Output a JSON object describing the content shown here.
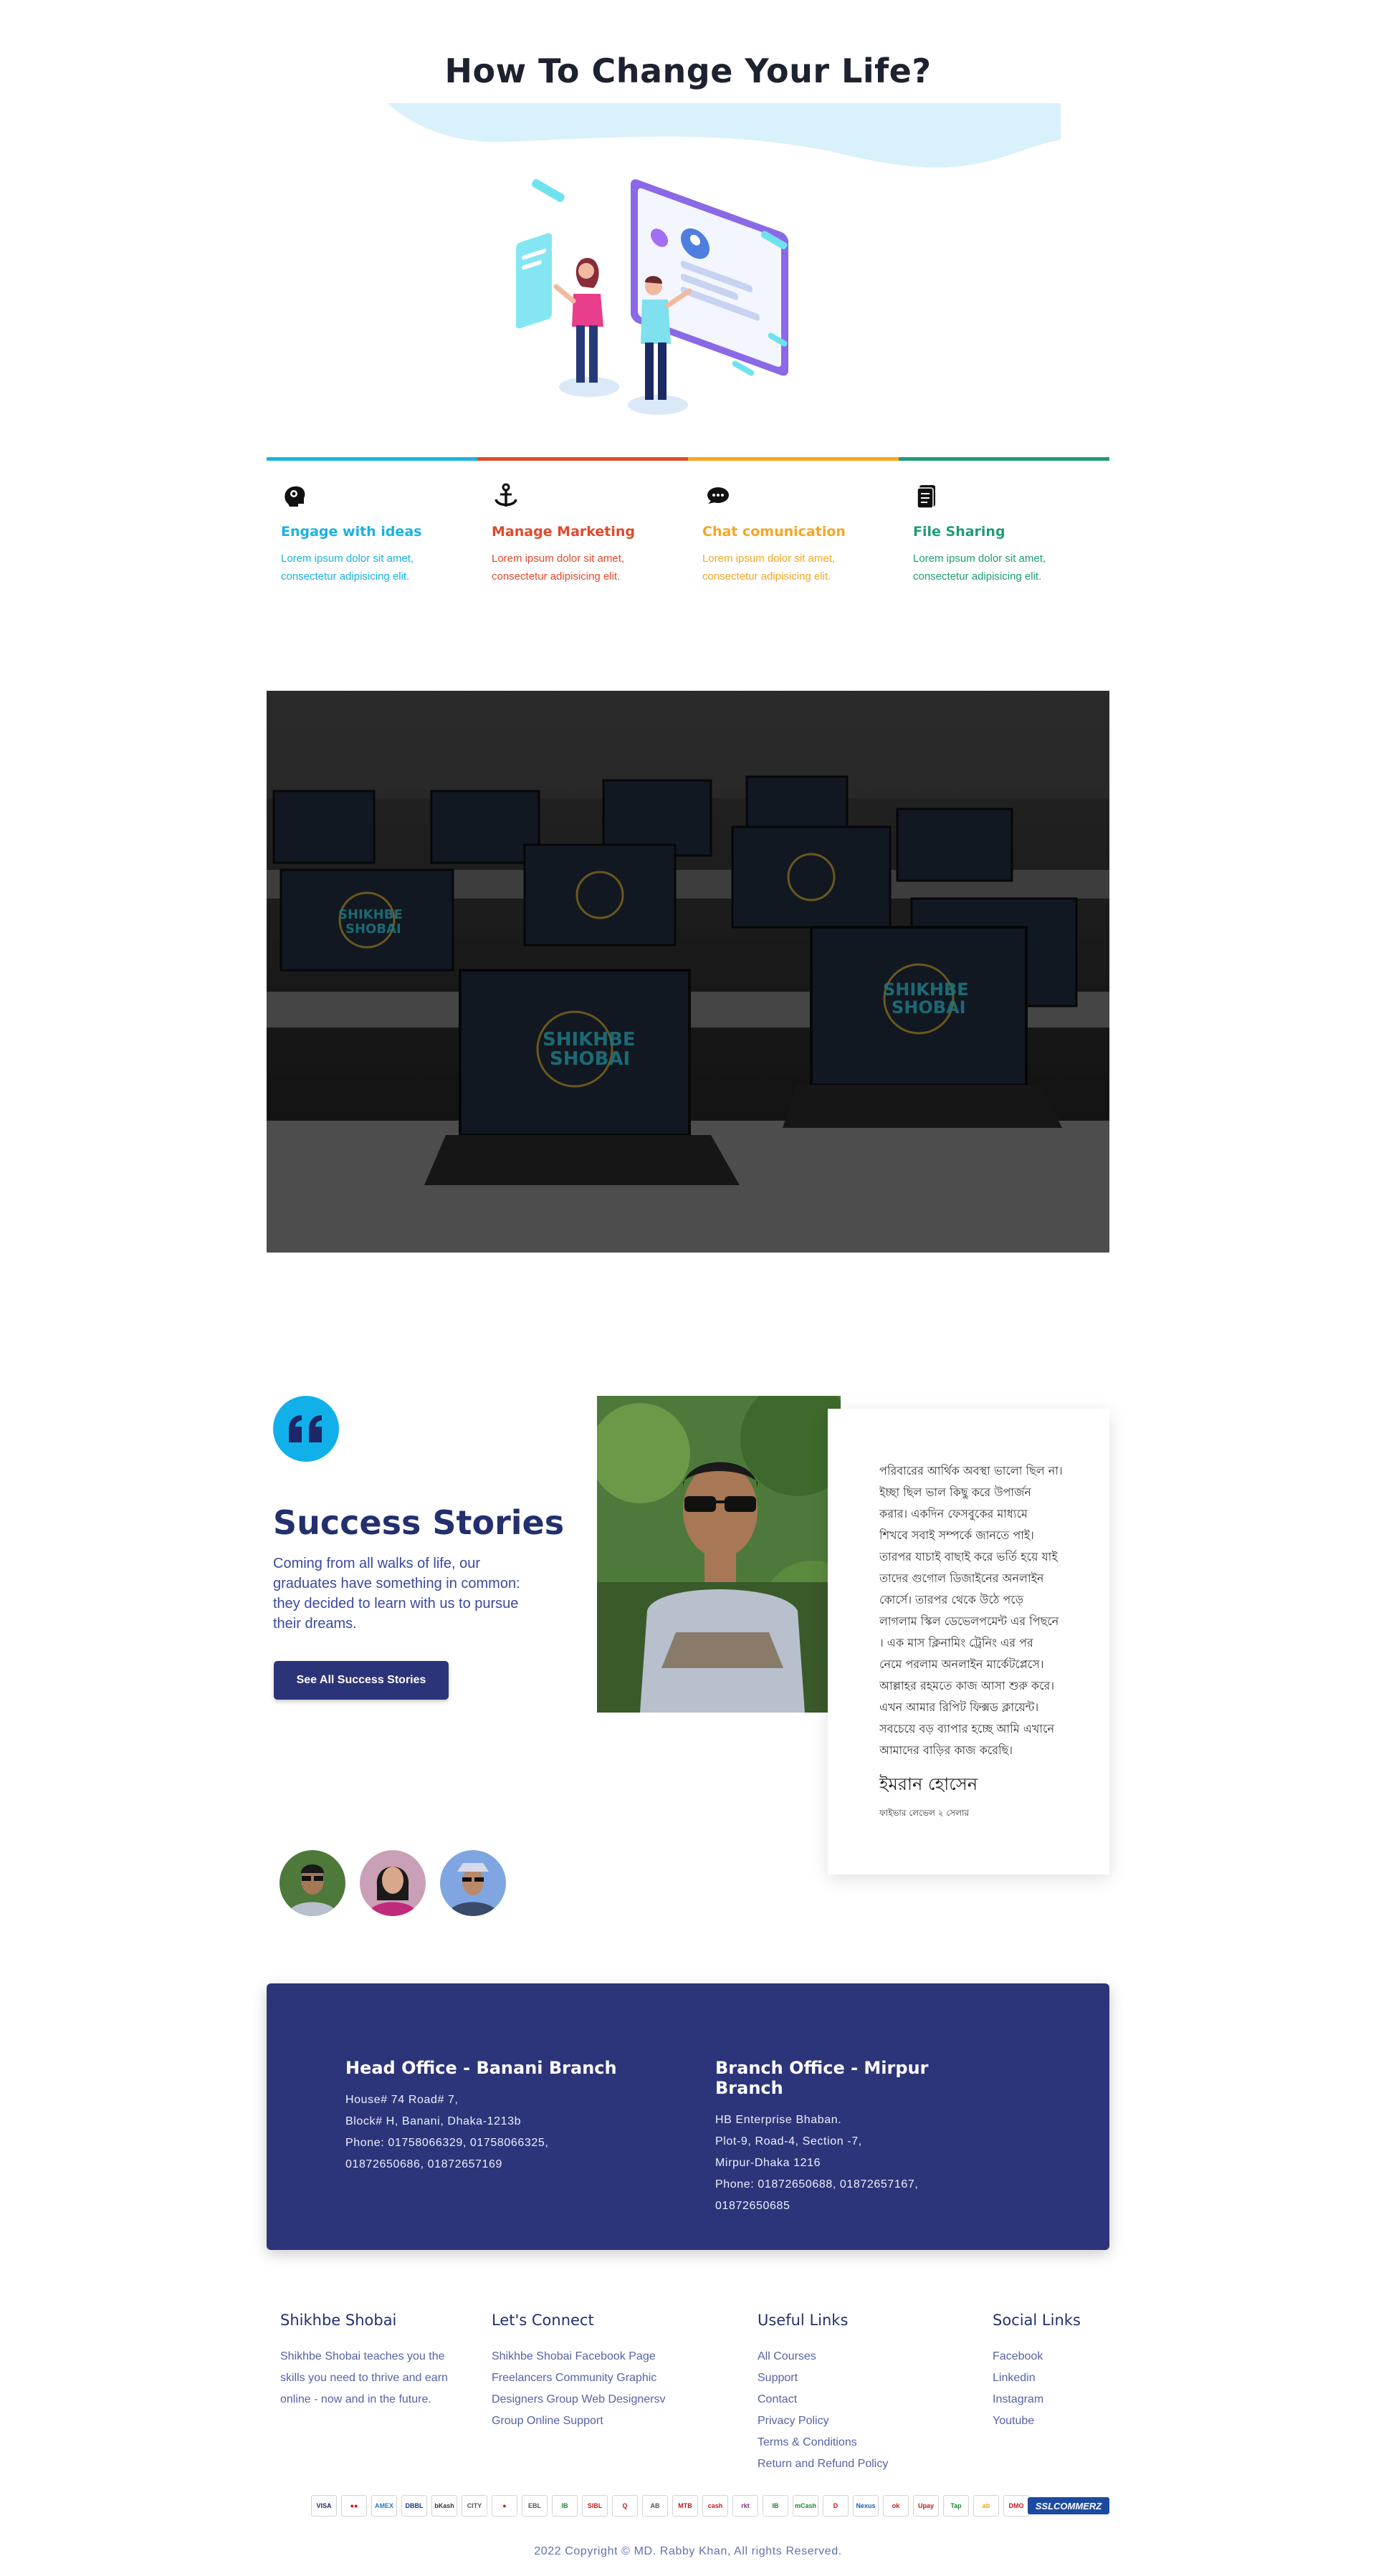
{
  "hero": {
    "title": "How To Change Your Life?"
  },
  "features": [
    {
      "icon": "brain-icon",
      "title": "Engage with ideas",
      "desc": "Lorem ipsum dolor sit amet, consectetur adipisicing elit.",
      "color": "#1ab2e0"
    },
    {
      "icon": "anchor-icon",
      "title": "Manage Marketing",
      "desc": "Lorem ipsum dolor sit amet, consectetur adipisicing elit.",
      "color": "#e0492c"
    },
    {
      "icon": "chat-icon",
      "title": "Chat comunication",
      "desc": "Lorem ipsum dolor sit amet, consectetur adipisicing elit.",
      "color": "#f5a623"
    },
    {
      "icon": "file-icon",
      "title": "File Sharing",
      "desc": "Lorem ipsum dolor sit amet, consectetur adipisicing elit.",
      "color": "#1f9c7a"
    }
  ],
  "success": {
    "title": "Success Stories",
    "desc": "Coming from all walks of life, our graduates have something in common: they decided to learn with us to pursue their dreams.",
    "button": "See All Success Stories",
    "story_lines": [
      "পরিবারের আর্থিক অবস্থা ভালো ছিল না।",
      "ইচ্ছা ছিল ভাল কিছু করে উপার্জন",
      "করার। একদিন ফেসবুকের মাধ্যমে",
      "শিখবে সবাই সম্পর্কে জানতে পাই।",
      "তারপর যাচাই বাছাই করে ভর্তি হয়ে যাই",
      "তাদের গুগোল ডিজাইনের অনলাইন",
      "কোর্সে। তারপর থেকে উঠে পড়ে",
      "লাগলাম স্কিল ডেভেলপমেন্ট এর পিছনে",
      "। এক মাস ক্লিনামিং ট্রেনিং এর পর",
      "নেমে পরলাম অনলাইন মার্কেটপ্লেসে।",
      "আল্লাহর রহমতে কাজ আসা শুরু করে।",
      "এখন আমার রিপিট ফিক্সড ক্লায়েন্ট।",
      "সবচেয়ে বড় ব্যাপার হচ্ছে আমি এখানে",
      "আমাদের বাড়ির কাজ করেছি।"
    ],
    "name": "ইমরান হোসেন",
    "role": "ফাইভার লেভেল ২ সেলার"
  },
  "offices": [
    {
      "title": "Head Office - Banani Branch",
      "lines": [
        "House# 74 Road# 7,",
        "Block# H, Banani, Dhaka-1213b",
        "Phone: 01758066329, 01758066325,",
        "01872650686, 01872657169"
      ]
    },
    {
      "title": "Branch Office - Mirpur Branch",
      "lines": [
        "HB Enterprise Bhaban.",
        "Plot-9, Road-4, Section -7,",
        "Mirpur-Dhaka 1216",
        "Phone: 01872650688, 01872657167,",
        "01872650685"
      ]
    }
  ],
  "footer": {
    "about": {
      "heading": "Shikhbe Shobai",
      "lines": [
        "Shikhbe Shobai teaches you the",
        "skills you need to thrive and earn",
        "online - now and in the future."
      ]
    },
    "connect": {
      "heading": "Let's Connect",
      "lines": [
        "Shikhbe Shobai Facebook Page",
        "Freelancers Community Graphic",
        "Designers Group Web Designersv",
        "Group Online Support"
      ]
    },
    "useful": {
      "heading": "Useful Links",
      "links": [
        "All Courses",
        "Support",
        "Contact",
        "Privacy Policy",
        "Terms & Conditions",
        "Return and Refund Policy"
      ]
    },
    "social": {
      "heading": "Social Links",
      "links": [
        "Facebook",
        "Linkedin",
        "Instagram",
        "Youtube"
      ]
    },
    "payments": [
      {
        "label": "VISA",
        "color": "#1a1f71"
      },
      {
        "label": "●●",
        "color": "#eb001b"
      },
      {
        "label": "AMEX",
        "color": "#2e77bb"
      },
      {
        "label": "DBBL",
        "color": "#0b3a8c"
      },
      {
        "label": "bKash",
        "color": "#333"
      },
      {
        "label": "CITY",
        "color": "#555"
      },
      {
        "label": "●",
        "color": "#c21818"
      },
      {
        "label": "EBL",
        "color": "#555"
      },
      {
        "label": "IB",
        "color": "#1a8a2e"
      },
      {
        "label": "SIBL",
        "color": "#cc1f1f"
      },
      {
        "label": "Q",
        "color": "#cc1f1f"
      },
      {
        "label": "AB",
        "color": "#555"
      },
      {
        "label": "MTB",
        "color": "#c21818"
      },
      {
        "label": "cash",
        "color": "#c21818"
      },
      {
        "label": "rkt",
        "color": "#8e2a8a"
      },
      {
        "label": "IB",
        "color": "#1a8a2e"
      },
      {
        "label": "mCash",
        "color": "#1a8a2e"
      },
      {
        "label": "D",
        "color": "#c21818"
      },
      {
        "label": "Nexus",
        "color": "#1f5bb5"
      },
      {
        "label": "ok",
        "color": "#c21818"
      },
      {
        "label": "Upay",
        "color": "#c21818"
      },
      {
        "label": "Tap",
        "color": "#1a8a2e"
      },
      {
        "label": "ab",
        "color": "#e8a30b"
      },
      {
        "label": "DMO",
        "color": "#c21818"
      }
    ],
    "ssl": "SSLCOMMERZ",
    "copyright": "2022 Copyright © MD. Rabby Khan, All rights Reserved."
  }
}
